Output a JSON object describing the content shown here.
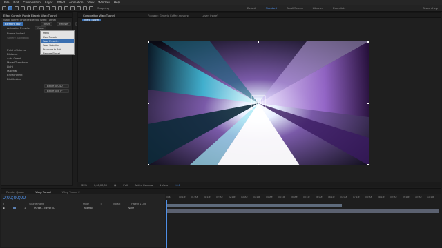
{
  "menubar": [
    "File",
    "Edit",
    "Composition",
    "Layer",
    "Effect",
    "Animation",
    "View",
    "Window",
    "Help"
  ],
  "toolbar": {
    "snapping": "Snapping",
    "workspaces": [
      "Default",
      "Standard",
      "Small Screen",
      "Libraries",
      "Essentials"
    ],
    "active_workspace": "Standard",
    "search": "Search Help"
  },
  "effect_controls": {
    "tab": "Effect Controls Purple Electric Warp Tunnel",
    "breadcrumb": "Warp Tunnel • Purple Electric Warp Tunnel",
    "effect_name": "Element (3D)",
    "buttons": [
      "Reset",
      "Register",
      "Help"
    ],
    "animation_presets_label": "Animation Presets",
    "animation_presets_value": "None",
    "rows": [
      "Frame Locked",
      "Sphere Animation",
      "Point of Interest",
      "Distance",
      "Auto-Orient",
      "Model Transform",
      "Light",
      "Material",
      "Environment",
      "Distribution"
    ],
    "export_buttons": [
      "Export to C4D",
      "Export to glTF"
    ]
  },
  "dropdown": {
    "items": [
      "Menu",
      "User Presets",
      "Save Preset...",
      "Save Selection",
      "Purchase to Add",
      "Remove Preset",
      "Workspace (Pan)"
    ],
    "highlighted_index": 2
  },
  "composition": {
    "tab": "Composition Warp Tunnel",
    "subtab": "Warp Tunnel",
    "footage_tab": "Footage: Generic Coffee.mov.png",
    "layer_tab": "Layer: (none)"
  },
  "viewer_footer": {
    "zoom": "33%",
    "timecode": "0;00;00;00",
    "resolution": "Full",
    "camera": "Active Camera",
    "views": "1 View",
    "offset": "+0.0"
  },
  "timeline": {
    "tabs": [
      "Render Queue",
      "Warp Tunnel",
      "Warp Tunnel 2"
    ],
    "active_tab": "Warp Tunnel",
    "timecode": "0;00;00;00",
    "columns": [
      "#",
      "Source Name",
      "Mode",
      "T",
      "TrkMat",
      "Parent & Link"
    ],
    "layer": {
      "index": "1",
      "name": "Purple... Tunnel 2D",
      "mode": "Normal",
      "parent": "None"
    },
    "ruler": [
      "00s",
      "00:15f",
      "01:00f",
      "01:15f",
      "02:00f",
      "02:15f",
      "03:00f",
      "03:15f",
      "04:00f",
      "04:15f",
      "05:00f",
      "05:15f",
      "06:00f",
      "06:15f",
      "07:00f",
      "07:15f",
      "08:00f",
      "08:15f",
      "09:00f",
      "09:15f",
      "10:00f",
      "10:15f"
    ]
  },
  "colors": {
    "accent": "#4f8fe6",
    "panel": "#232323",
    "background": "#1d1d1d"
  }
}
